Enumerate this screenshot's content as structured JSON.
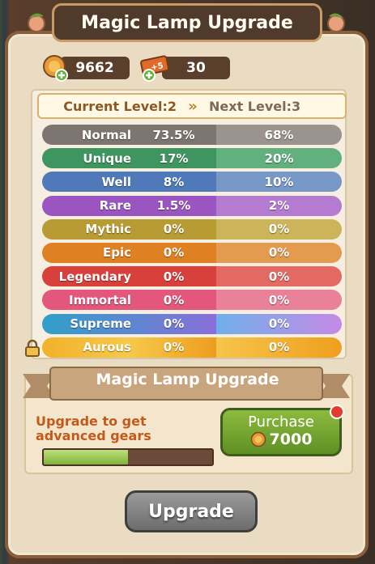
{
  "title": "Magic Lamp Upgrade",
  "resources": {
    "coins": "9662",
    "tickets": "30",
    "ticket_badge": "+5"
  },
  "levels": {
    "current": "Current Level:2",
    "arrow": "»",
    "next": "Next Level:3"
  },
  "rarities": [
    {
      "name": "Normal",
      "current": "73.5%",
      "next": "68%",
      "color1": "#7d7570",
      "color2": "#9b938d"
    },
    {
      "name": "Unique",
      "current": "17%",
      "next": "20%",
      "color1": "#3f9560",
      "color2": "#62b07d"
    },
    {
      "name": "Well",
      "current": "8%",
      "next": "10%",
      "color1": "#4f79b9",
      "color2": "#7898c8"
    },
    {
      "name": "Rare",
      "current": "1.5%",
      "next": "2%",
      "color1": "#9a55c1",
      "color2": "#b57bd1"
    },
    {
      "name": "Mythic",
      "current": "0%",
      "next": "0%",
      "color1": "#b89b33",
      "color2": "#cbb45a"
    },
    {
      "name": "Epic",
      "current": "0%",
      "next": "0%",
      "color1": "#df8022",
      "color2": "#e49b4f"
    },
    {
      "name": "Legendary",
      "current": "0%",
      "next": "0%",
      "color1": "#d8403c",
      "color2": "#e26a63"
    },
    {
      "name": "Immortal",
      "current": "0%",
      "next": "0%",
      "color1": "#e2577b",
      "color2": "#e98198"
    },
    {
      "name": "Supreme",
      "current": "0%",
      "next": "0%",
      "color1": "#2fa0c8",
      "color2": "#b47be0"
    },
    {
      "name": "Aurous",
      "current": "0%",
      "next": "0%",
      "color1": "#f2b12b",
      "color2": "#f0a21c"
    }
  ],
  "upgrade_section": {
    "title": "Magic Lamp Upgrade",
    "hint": "Upgrade to get advanced gears",
    "progress": 0.5
  },
  "purchase": {
    "label": "Purchase",
    "cost": "7000"
  },
  "upgrade_button": "Upgrade",
  "colors": {
    "accent_green": "#6fa22e",
    "panel": "#e9dcc2",
    "banner": "#4f3a2c"
  }
}
